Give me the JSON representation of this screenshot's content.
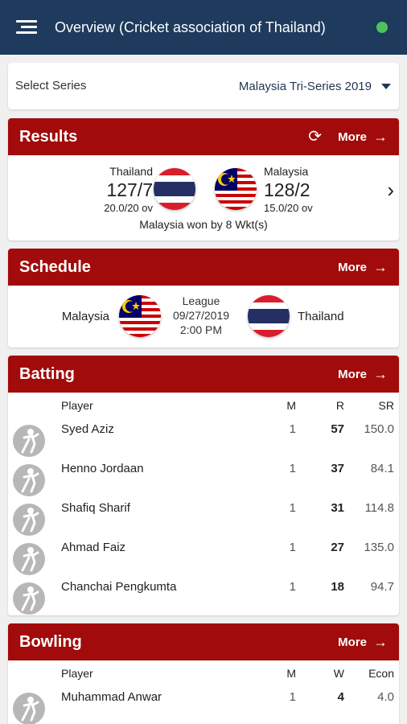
{
  "header": {
    "title": "Overview (Cricket association of Thailand)",
    "status_color": "#4cc35a"
  },
  "series": {
    "label": "Select Series",
    "selected": "Malaysia Tri-Series 2019"
  },
  "results": {
    "title": "Results",
    "more_label": "More",
    "team_left": {
      "name": "Thailand",
      "score": "127/7",
      "overs": "20.0/20 ov",
      "flag": "thailand-flag"
    },
    "team_right": {
      "name": "Malaysia",
      "score": "128/2",
      "overs": "15.0/20 ov",
      "flag": "malaysia-flag"
    },
    "summary": "Malaysia won by 8 Wkt(s)"
  },
  "schedule": {
    "title": "Schedule",
    "more_label": "More",
    "team_left": "Malaysia",
    "team_right": "Thailand",
    "type": "League",
    "date": "09/27/2019",
    "time": "2:00 PM"
  },
  "batting": {
    "title": "Batting",
    "more_label": "More",
    "columns": {
      "player": "Player",
      "m": "M",
      "r": "R",
      "sr": "SR"
    },
    "rows": [
      {
        "name": "Syed Aziz",
        "m": "1",
        "r": "57",
        "sr": "150.0"
      },
      {
        "name": "Henno Jordaan",
        "m": "1",
        "r": "37",
        "sr": "84.1"
      },
      {
        "name": "Shafiq Sharif",
        "m": "1",
        "r": "31",
        "sr": "114.8"
      },
      {
        "name": "Ahmad Faiz",
        "m": "1",
        "r": "27",
        "sr": "135.0"
      },
      {
        "name": "Chanchai Pengkumta",
        "m": "1",
        "r": "18",
        "sr": "94.7"
      }
    ]
  },
  "bowling": {
    "title": "Bowling",
    "more_label": "More",
    "columns": {
      "player": "Player",
      "m": "M",
      "w": "W",
      "econ": "Econ"
    },
    "rows": [
      {
        "name": "Muhammad Anwar",
        "m": "1",
        "w": "4",
        "econ": "4.0"
      }
    ]
  },
  "colors": {
    "header_bg": "#1e3a5c",
    "section_red": "#a10b0b",
    "accent_text": "#1f3553"
  }
}
